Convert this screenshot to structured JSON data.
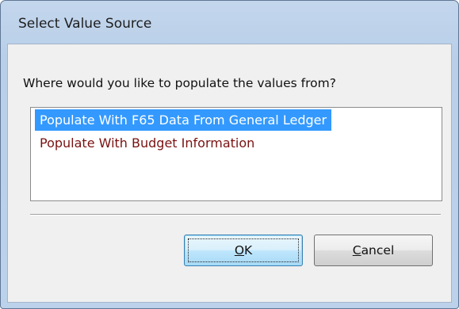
{
  "window": {
    "title": "Select Value Source"
  },
  "dialog": {
    "prompt": "Where would you like to populate the values from?",
    "options": [
      {
        "label": "Populate With F65 Data From General Ledger",
        "selected": true
      },
      {
        "label": "Populate With Budget Information",
        "selected": false
      }
    ],
    "ok": {
      "accel": "O",
      "rest": "K"
    },
    "cancel": {
      "accel": "C",
      "rest": "ancel"
    }
  },
  "colors": {
    "selection": "#3399ff",
    "option_text": "#7a1111",
    "frame": "#b9cfe9"
  }
}
